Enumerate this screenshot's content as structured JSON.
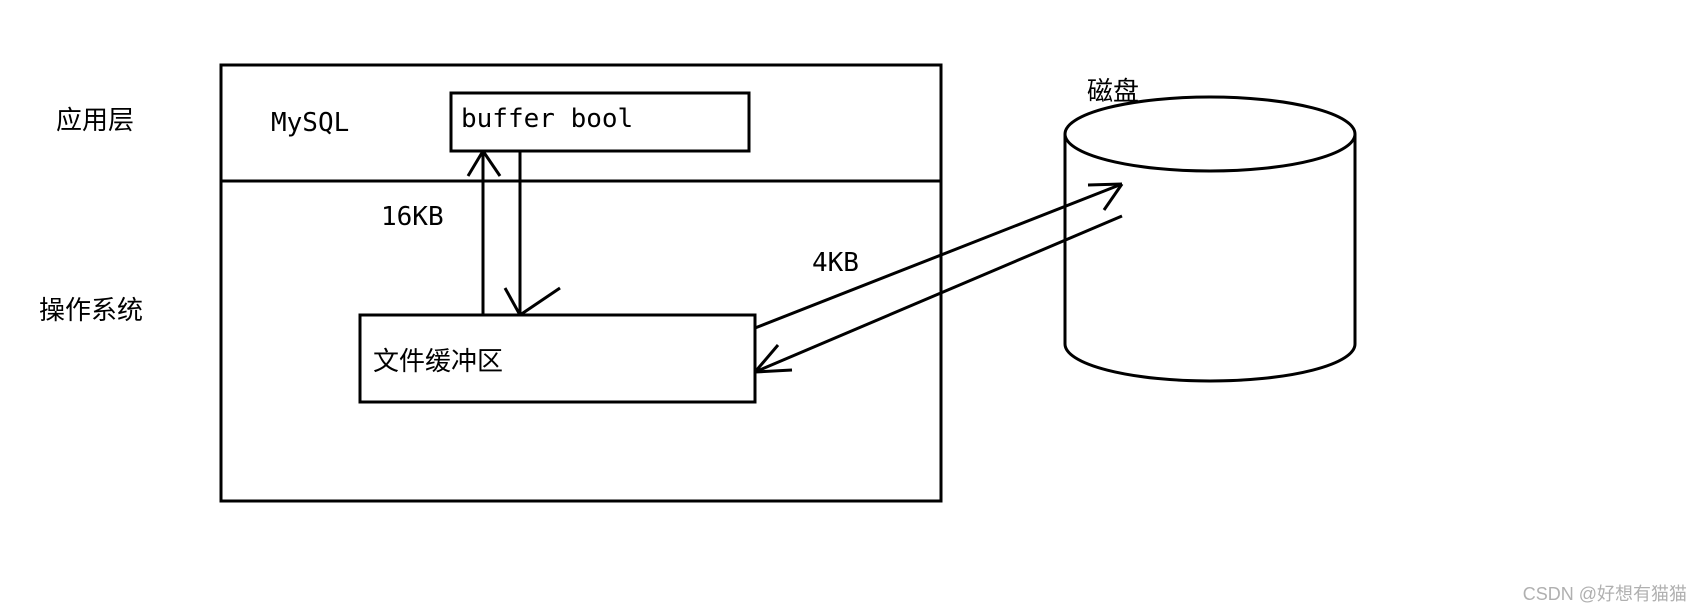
{
  "labels": {
    "app_layer": "应用层",
    "os_layer": "操作系统",
    "mysql": "MySQL",
    "buffer_pool": "buffer bool",
    "file_cache": "文件缓冲区",
    "size_16kb": "16KB",
    "size_4kb": "4KB",
    "disk": "磁盘"
  },
  "watermark": "CSDN @好想有猫猫"
}
